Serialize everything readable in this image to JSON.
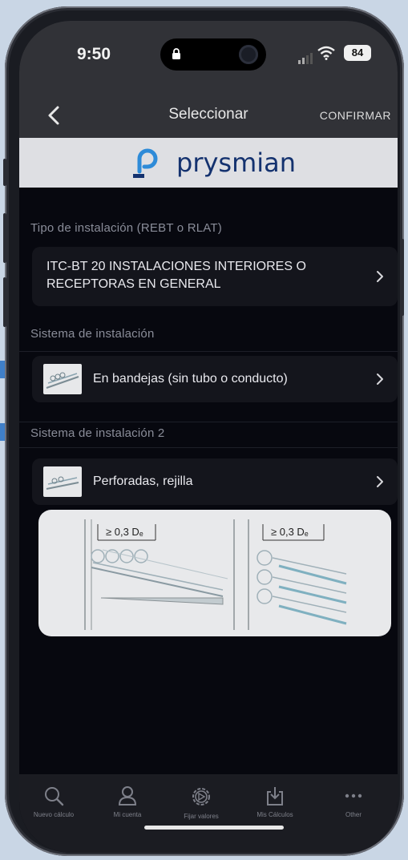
{
  "status_bar": {
    "time": "9:50",
    "battery": "84"
  },
  "nav": {
    "title": "Seleccionar",
    "confirm_label": "CONFIRMAR"
  },
  "brand": {
    "name": "prysmian"
  },
  "sections": {
    "installation_type": {
      "label": "Tipo de instalación (REBT o RLAT)",
      "value_line1": "ITC-BT 20 INSTALACIONES INTERIORES O",
      "value_line2": "RECEPTORAS EN GENERAL"
    },
    "installation_system": {
      "label": "Sistema de instalación",
      "value": "En bandejas (sin tubo o conducto)"
    },
    "installation_system_2": {
      "label": "Sistema de instalación 2",
      "value": "Perforadas, rejilla"
    }
  },
  "diagram": {
    "left_label": "≥ 0,3 Dₑ",
    "right_label": "≥ 0,3 Dₑ"
  },
  "tabbar": {
    "items": [
      {
        "label": "Nuevo cálculo",
        "icon": "search-icon"
      },
      {
        "label": "Mi cuenta",
        "icon": "user-icon"
      },
      {
        "label": "Fijar valores",
        "icon": "gear-icon"
      },
      {
        "label": "Mis Cálculos",
        "icon": "download-icon"
      },
      {
        "label": "Other",
        "icon": "more-icon"
      }
    ]
  },
  "colors": {
    "brand_blue": "#14326f",
    "brand_accent": "#2e8bd8",
    "background": "#07080f",
    "card": "#14151c"
  }
}
